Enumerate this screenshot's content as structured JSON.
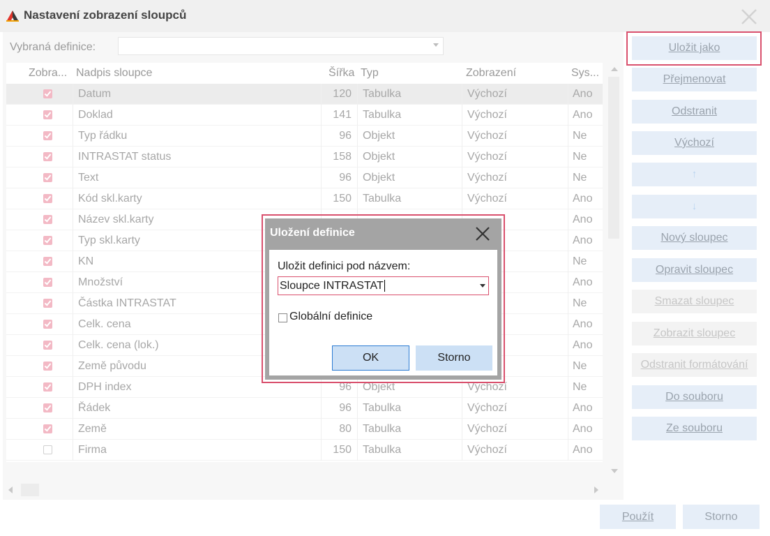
{
  "window": {
    "title": "Nastavení zobrazení sloupců"
  },
  "definition": {
    "label": "Vybraná definice:",
    "value": ""
  },
  "columns": [
    "Zobra...",
    "Nadpis sloupce",
    "Šířka",
    "Typ",
    "Zobrazení",
    "Sys..."
  ],
  "rows": [
    {
      "checked": true,
      "name": "Datum",
      "width": "120",
      "type": "Tabulka",
      "display": "Výchozí",
      "system": "Ano"
    },
    {
      "checked": true,
      "name": "Doklad",
      "width": "141",
      "type": "Tabulka",
      "display": "Výchozí",
      "system": "Ano"
    },
    {
      "checked": true,
      "name": "Typ řádku",
      "width": "96",
      "type": "Objekt",
      "display": "Výchozí",
      "system": "Ne"
    },
    {
      "checked": true,
      "name": "INTRASTAT status",
      "width": "158",
      "type": "Objekt",
      "display": "Výchozí",
      "system": "Ne"
    },
    {
      "checked": true,
      "name": "Text",
      "width": "96",
      "type": "Objekt",
      "display": "Výchozí",
      "system": "Ne"
    },
    {
      "checked": true,
      "name": "Kód skl.karty",
      "width": "150",
      "type": "Tabulka",
      "display": "Výchozí",
      "system": "Ano"
    },
    {
      "checked": true,
      "name": "Název skl.karty",
      "width": "",
      "type": "",
      "display": "",
      "system": "Ano"
    },
    {
      "checked": true,
      "name": "Typ skl.karty",
      "width": "",
      "type": "",
      "display": "",
      "system": "Ano"
    },
    {
      "checked": true,
      "name": "KN",
      "width": "",
      "type": "",
      "display": "",
      "system": "Ne"
    },
    {
      "checked": true,
      "name": "Množství",
      "width": "",
      "type": "",
      "display": "",
      "system": "Ano"
    },
    {
      "checked": true,
      "name": "Částka INTRASTAT",
      "width": "",
      "type": "",
      "display": "",
      "system": "Ne"
    },
    {
      "checked": true,
      "name": "Celk. cena",
      "width": "",
      "type": "",
      "display": "",
      "system": "Ano"
    },
    {
      "checked": true,
      "name": "Celk. cena (lok.)",
      "width": "",
      "type": "",
      "display": "",
      "system": "Ano"
    },
    {
      "checked": true,
      "name": "Země původu",
      "width": "",
      "type": "",
      "display": "",
      "system": "Ne"
    },
    {
      "checked": true,
      "name": "DPH index",
      "width": "96",
      "type": "Objekt",
      "display": "Výchozí",
      "system": "Ne"
    },
    {
      "checked": true,
      "name": "Řádek",
      "width": "96",
      "type": "Tabulka",
      "display": "Výchozí",
      "system": "Ano"
    },
    {
      "checked": true,
      "name": "Země",
      "width": "80",
      "type": "Tabulka",
      "display": "Výchozí",
      "system": "Ano"
    },
    {
      "checked": false,
      "name": "Firma",
      "width": "150",
      "type": "Tabulka",
      "display": "Výchozí",
      "system": "Ano"
    }
  ],
  "side_buttons": [
    {
      "label": "Uložit jako",
      "enabled": true
    },
    {
      "label": "Přejmenovat",
      "enabled": true
    },
    {
      "label": "Odstranit",
      "enabled": true
    },
    {
      "label": "Výchozí",
      "enabled": true
    },
    {
      "label": "↑",
      "enabled": true,
      "icon": "arrow-up-icon"
    },
    {
      "label": "↓",
      "enabled": true,
      "icon": "arrow-down-icon"
    },
    {
      "label": "Nový sloupec",
      "enabled": true
    },
    {
      "label": "Opravit sloupec",
      "enabled": true
    },
    {
      "label": "Smazat sloupec",
      "enabled": false
    },
    {
      "label": "Zobrazit sloupec",
      "enabled": false
    },
    {
      "label": "Odstranit formátování",
      "enabled": false
    },
    {
      "label": "Do souboru",
      "enabled": true
    },
    {
      "label": "Ze souboru",
      "enabled": true
    }
  ],
  "bottom_buttons": {
    "apply": "Použít",
    "cancel": "Storno"
  },
  "dialog": {
    "title": "Uložení definice",
    "label": "Uložit definici pod názvem:",
    "value": "Sloupce INTRASTAT",
    "global_label": "Globální definice",
    "global_checked": false,
    "ok": "OK",
    "cancel": "Storno"
  },
  "colors": {
    "accent": "#d9506d",
    "button_bg": "#e6eef8",
    "check_on": "#f3b9c5",
    "dialog_frame": "#a4a4a4"
  }
}
